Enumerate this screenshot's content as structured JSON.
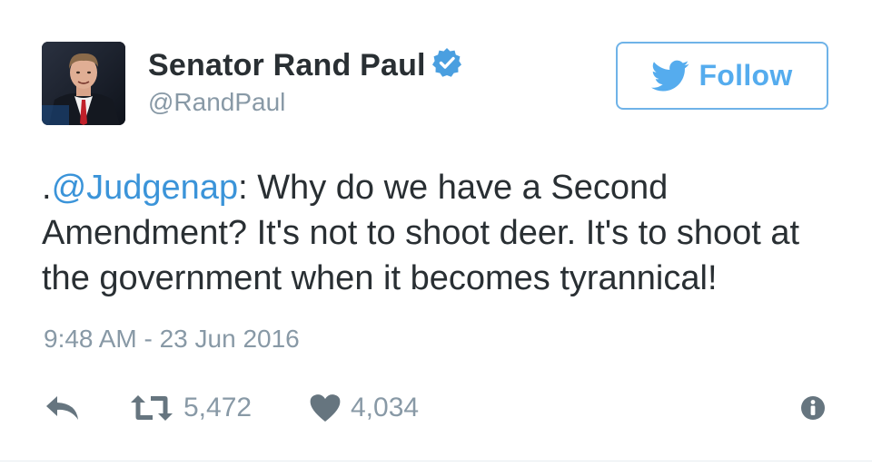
{
  "author": {
    "display_name": "Senator Rand Paul",
    "handle": "@RandPaul",
    "verified": true
  },
  "follow_button": {
    "label": "Follow",
    "icon": "twitter-bird-icon"
  },
  "tweet": {
    "prefix": ".",
    "mention": "@Judgenap",
    "text": ": Why do we have a Second Amendment? It's not to shoot deer. It's to shoot at the government when it becomes tyrannical!",
    "timestamp": "9:48 AM - 23 Jun 2016"
  },
  "actions": {
    "reply_icon": "reply-icon",
    "retweet_icon": "retweet-icon",
    "retweet_count": "5,472",
    "like_icon": "heart-icon",
    "like_count": "4,034",
    "info_icon": "info-icon"
  },
  "colors": {
    "accent": "#55acee",
    "mention": "#3b94d9",
    "text": "#292f33",
    "muted": "#8899a6"
  }
}
